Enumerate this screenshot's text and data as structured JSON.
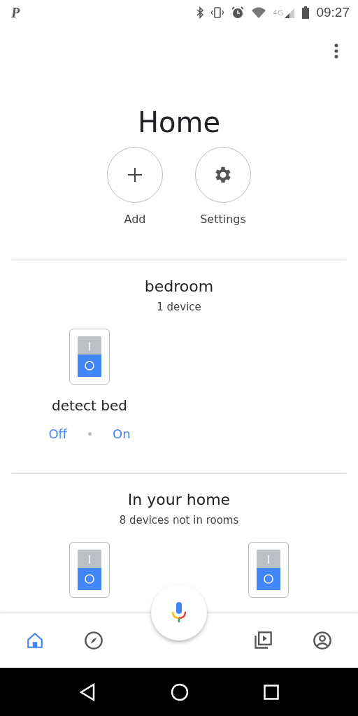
{
  "status_bar": {
    "app_letter": "P",
    "network": "4G",
    "time": "09:27"
  },
  "title": "Home",
  "actions": [
    {
      "kind": "add",
      "label": "Add"
    },
    {
      "kind": "settings",
      "label": "Settings"
    }
  ],
  "rooms": [
    {
      "name": "bedroom",
      "count": "1 device",
      "devices": [
        {
          "name": "detect bed",
          "on": false,
          "off_label": "Off",
          "on_label": "On"
        }
      ]
    }
  ],
  "unassigned": {
    "title": "In your home",
    "count": "8 devices not in rooms",
    "devices": [
      {
        "on": false
      },
      {
        "on": false
      }
    ]
  },
  "nav": [
    {
      "kind": "home",
      "selected": true
    },
    {
      "kind": "discover",
      "selected": false
    },
    {
      "kind": "media",
      "selected": false
    },
    {
      "kind": "account",
      "selected": false
    }
  ]
}
